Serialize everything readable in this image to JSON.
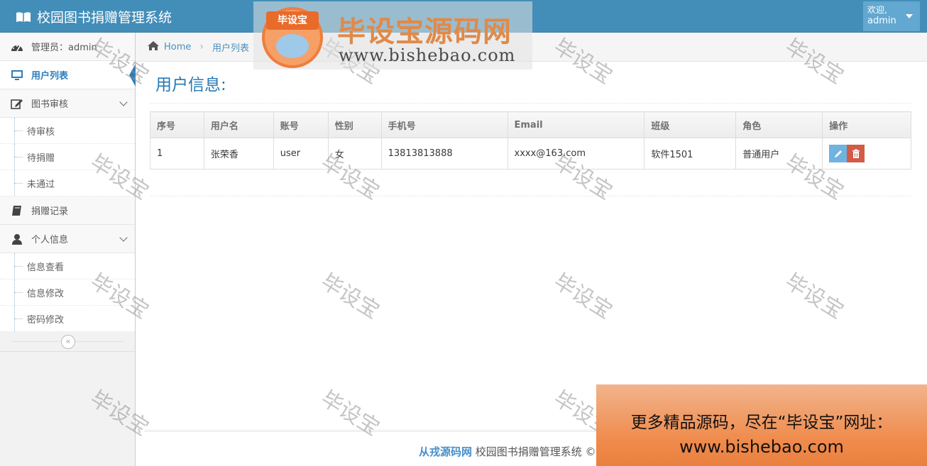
{
  "app": {
    "title": "校园图书捐赠管理系统"
  },
  "header": {
    "welcome": "欢迎,",
    "username": "admin"
  },
  "sidebar": {
    "admin_label": "管理员：admin",
    "items": [
      {
        "label": "用户列表",
        "icon": "desktop-icon"
      },
      {
        "label": "图书审核",
        "icon": "edit-icon",
        "children": [
          "待审核",
          "待捐赠",
          "未通过"
        ]
      },
      {
        "label": "捐赠记录",
        "icon": "book-icon"
      },
      {
        "label": "个人信息",
        "icon": "user-icon",
        "children": [
          "信息查看",
          "信息修改",
          "密码修改"
        ]
      }
    ],
    "collapse_glyph": "«"
  },
  "breadcrumb": {
    "home": "Home",
    "current": "用户列表"
  },
  "main": {
    "title": "用户信息:",
    "table": {
      "headers": [
        "序号",
        "用户名",
        "账号",
        "性别",
        "手机号",
        "Email",
        "班级",
        "角色",
        "操作"
      ],
      "rows": [
        {
          "id": "1",
          "name": "张荣香",
          "account": "user",
          "gender": "女",
          "phone": "13813813888",
          "email": "xxxx@163.com",
          "class": "软件1501",
          "role": "普通用户"
        }
      ]
    }
  },
  "footer": {
    "brand": "从戎源码网",
    "text": " 校园图书捐赠管理系统 ©"
  },
  "overlay": {
    "watermark": "毕设宝",
    "logo_badge": "毕设宝",
    "logo_title": "毕设宝源码网",
    "logo_url": "www.bishebao.com",
    "promo_line1": "更多精品源码，尽在“毕设宝”网址：",
    "promo_line2": "www.bishebao.com"
  },
  "colors": {
    "navbar": "#438eb9",
    "accent": "#2b7dbc",
    "edit": "#6fb3e0",
    "delete": "#d15b47"
  }
}
